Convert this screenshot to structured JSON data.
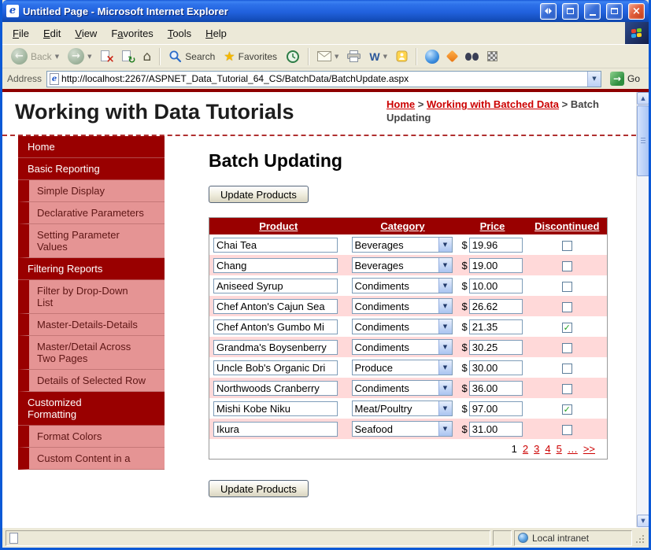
{
  "window": {
    "title": "Untitled Page - Microsoft Internet Explorer",
    "menu": {
      "items": [
        {
          "label": "File",
          "accel": 0
        },
        {
          "label": "Edit",
          "accel": 0
        },
        {
          "label": "View",
          "accel": 0
        },
        {
          "label": "Favorites",
          "accel": 1
        },
        {
          "label": "Tools",
          "accel": 0
        },
        {
          "label": "Help",
          "accel": 0
        }
      ]
    },
    "toolbar": {
      "back_label": "Back",
      "search_label": "Search",
      "favorites_label": "Favorites"
    },
    "address": {
      "label": "Address",
      "url": "http://localhost:2267/ASPNET_Data_Tutorial_64_CS/BatchData/BatchUpdate.aspx",
      "go_label": "Go"
    },
    "status": {
      "zone_label": "Local intranet"
    }
  },
  "page": {
    "site_title": "Working with Data Tutorials",
    "breadcrumb": {
      "separator": ">",
      "links": [
        "Home",
        "Working with Batched Data"
      ],
      "current": "Batch Updating"
    },
    "sidebar": [
      {
        "label": "Home",
        "type": "header"
      },
      {
        "label": "Basic Reporting",
        "type": "header"
      },
      {
        "label": "Simple Display",
        "type": "sub"
      },
      {
        "label": "Declarative Parameters",
        "type": "sub"
      },
      {
        "label": "Setting Parameter Values",
        "type": "sub"
      },
      {
        "label": "Filtering Reports",
        "type": "header"
      },
      {
        "label": "Filter by Drop-Down List",
        "type": "sub"
      },
      {
        "label": "Master-Details-Details",
        "type": "sub"
      },
      {
        "label": "Master/Detail Across Two Pages",
        "type": "sub"
      },
      {
        "label": "Details of Selected Row",
        "type": "sub"
      },
      {
        "label": "Customized Formatting",
        "type": "header"
      },
      {
        "label": "Format Colors",
        "type": "sub"
      },
      {
        "label": "Custom Content in a",
        "type": "sub"
      }
    ],
    "main": {
      "title": "Batch Updating",
      "update_button_label": "Update Products",
      "currency": "$",
      "table": {
        "headers": [
          "Product",
          "Category",
          "Price",
          "Discontinued"
        ],
        "rows": [
          {
            "product": "Chai Tea",
            "category": "Beverages",
            "price": "19.96",
            "discontinued": false
          },
          {
            "product": "Chang",
            "category": "Beverages",
            "price": "19.00",
            "discontinued": false
          },
          {
            "product": "Aniseed Syrup",
            "category": "Condiments",
            "price": "10.00",
            "discontinued": false
          },
          {
            "product": "Chef Anton's Cajun Sea",
            "category": "Condiments",
            "price": "26.62",
            "discontinued": false
          },
          {
            "product": "Chef Anton's Gumbo Mi",
            "category": "Condiments",
            "price": "21.35",
            "discontinued": true
          },
          {
            "product": "Grandma's Boysenberry",
            "category": "Condiments",
            "price": "30.25",
            "discontinued": false
          },
          {
            "product": "Uncle Bob's Organic Dri",
            "category": "Produce",
            "price": "30.00",
            "discontinued": false
          },
          {
            "product": "Northwoods Cranberry",
            "category": "Condiments",
            "price": "36.00",
            "discontinued": false
          },
          {
            "product": "Mishi Kobe Niku",
            "category": "Meat/Poultry",
            "price": "97.00",
            "discontinued": true
          },
          {
            "product": "Ikura",
            "category": "Seafood",
            "price": "31.00",
            "discontinued": false
          }
        ],
        "pager": {
          "current": "1",
          "links": [
            "2",
            "3",
            "4",
            "5",
            "…",
            ">>"
          ]
        }
      }
    }
  },
  "colors": {
    "accent_dark_red": "#990000",
    "sidebar_sub_bg": "#e59494",
    "row_alt_pink": "#ffd9d9",
    "link_red": "#cc0000",
    "titlebar_blue": "#2161dd",
    "go_green": "#2f8f3f"
  },
  "icons": {
    "dropdown_arrow": "▼",
    "combo_arrow": "▼",
    "scroll_up": "▲",
    "scroll_down": "▼",
    "check": "✓",
    "go_arrow": "→",
    "back_arrow": "←",
    "forward_arrow": "→",
    "stop_glyph": "×",
    "refresh_glyph": "↻",
    "home_glyph": "⌂",
    "star_glyph": "★",
    "edit_letter": "W",
    "close_glyph": "×",
    "ie_letter": "e"
  }
}
